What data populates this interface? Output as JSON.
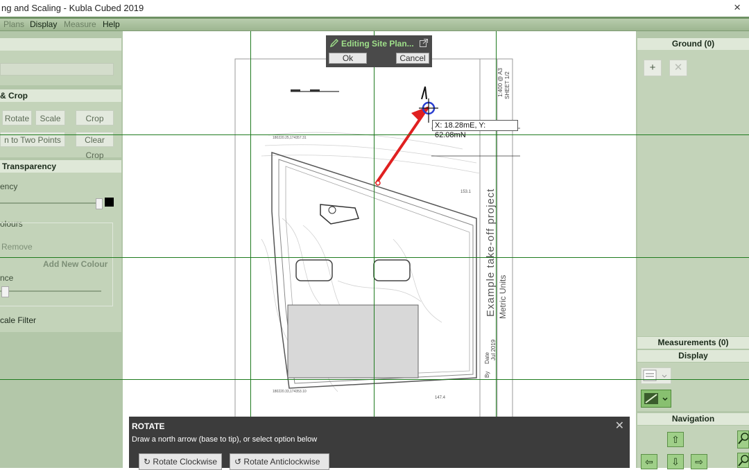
{
  "window": {
    "title": "ng and Scaling - Kubla Cubed 2019",
    "close_glyph": "×"
  },
  "menu": {
    "items": [
      "Plans",
      "Display",
      "Measure",
      "Help"
    ]
  },
  "left_panel": {
    "crop_header": "& Crop",
    "rotate": "Rotate",
    "scale": "Scale",
    "crop": "Crop",
    "two_points": "n to Two Points",
    "clear_crop": "Clear Crop",
    "transparency_header": "Transparency",
    "transparency_label": "ency",
    "colours_label": "olours",
    "remove": "Remove",
    "add_new_colour": "Add New Colour",
    "tolerance_label": "nce",
    "scale_filter": "cale Filter"
  },
  "right_panel": {
    "ground_header": "Ground (0)",
    "add_glyph": "+",
    "delete_glyph": "✕",
    "measurements_header": "Measurements (0)",
    "display_header": "Display",
    "navigation_header": "Navigation",
    "nav_up": "⇧",
    "nav_left": "⇦",
    "nav_down": "⇩",
    "nav_right": "⇨"
  },
  "edit_popup": {
    "title": "Editing Site Plan...",
    "ok": "Ok",
    "cancel": "Cancel"
  },
  "coord_readout": "X: 18.28mE, Y: 62.08mN",
  "drawing": {
    "scale_text": "1:400 @ A3",
    "sheet": "SHEET 1/2",
    "project": "Example take-off project",
    "units": "Metric Units",
    "date_label": "Date",
    "date": "Jul 2019",
    "by": "By",
    "coord_top": "180220.25,174357.31",
    "coord_bottom": "180220.33,174353.10",
    "dim_right": "147.4",
    "dim_top": "153.1"
  },
  "rotate_panel": {
    "title": "ROTATE",
    "description": "Draw a north arrow (base to tip), or select option below",
    "clockwise": "Rotate Clockwise",
    "anticlockwise": "Rotate Anticlockwise",
    "close_glyph": "✕"
  },
  "colors": {
    "accent": "#6e9163",
    "panel": "#b3c7a9",
    "grid": "#1e7a1e",
    "arrow": "#e02020"
  }
}
